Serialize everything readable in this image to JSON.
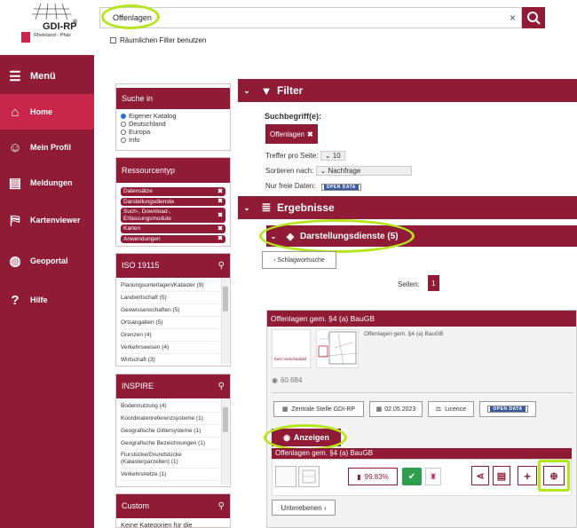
{
  "header": {
    "logo_text": "GDI-RP",
    "logo_sub": "Rheinland - Pfalz",
    "search_value": "Offenlagen",
    "geo_filter_label": "Räumlichen Filter benutzen"
  },
  "sidebar": {
    "menu": "Menü",
    "items": [
      {
        "label": "Home",
        "icon": "home-icon"
      },
      {
        "label": "Mein Profil",
        "icon": "profile-icon"
      },
      {
        "label": "Meldungen",
        "icon": "news-icon"
      },
      {
        "label": "Kartenviewer",
        "icon": "map-icon"
      },
      {
        "label": "Geoportal",
        "icon": "globe-icon"
      },
      {
        "label": "Hilfe",
        "icon": "help-icon"
      }
    ]
  },
  "search_in": {
    "title": "Suche in",
    "options": [
      "Eigener Katalog",
      "Deutschland",
      "Europa",
      "Info"
    ]
  },
  "resource_type": {
    "title": "Ressourcentyp",
    "chips": [
      "Datensätze",
      "Darstellungsdienste",
      "Such-, Download-, Erfassungsmodule",
      "Karten",
      "Anwendungen"
    ]
  },
  "iso": {
    "title": "ISO 19115",
    "items": [
      "Planungsunterlagen/Kataster (9)",
      "Landwirtschaft (5)",
      "Geowissenschaften (5)",
      "Ortsangaben (5)",
      "Grenzen (4)",
      "Verkehrswesen (4)",
      "Wirtschaft (3)"
    ]
  },
  "inspire": {
    "title": "INSPIRE",
    "items": [
      "Bodennutzung (4)",
      "Koordinatenreferenzsysteme (1)",
      "Geografische Gittersysteme (1)",
      "Geografische Bezeichnungen (1)",
      "Flurstücke/Grundstücke (Katasterparzellen) (1)",
      "Verkehrsnetze (1)"
    ]
  },
  "custom": {
    "title": "Custom",
    "text": "Keine Kategorien für die"
  },
  "filter": {
    "title": "Filter",
    "suchbegriff_label": "Suchbegriff(e):",
    "chip": "Offenlagen",
    "per_page_label": "Treffer pro Seite:",
    "per_page_value": "10",
    "sort_label": "Sortieren nach:",
    "sort_value": "Nachfrage",
    "free_label": "Nur freie Daten:",
    "open_data": "OPEN DATA"
  },
  "results": {
    "title": "Ergebnisse",
    "category": "Darstellungsdienste (5)",
    "keyword_btn": "Schlagwortsuche",
    "pages_label": "Seiten:",
    "page": "1"
  },
  "card": {
    "title": "Offenlagen gem. §4 (a) BauGB",
    "desc": "Offenlagen gem. §4 (a) BauGB",
    "thumb1": "Kein Vorschaubild",
    "views": "60.684",
    "org": "Zentrale Stelle GDI-RP",
    "date": "02.05.2023",
    "licence": "Licence",
    "open_data": "OPEN DATA",
    "show_btn": "Anzeigen",
    "layer_title": "Offenlagen gem. §4 (a) BauGB",
    "availability": "99.83%",
    "sublayers_btn": "Unterebenen"
  },
  "colors": {
    "brand": "#8f1b36",
    "active": "#c8264a",
    "highlight": "#b5e61d"
  }
}
